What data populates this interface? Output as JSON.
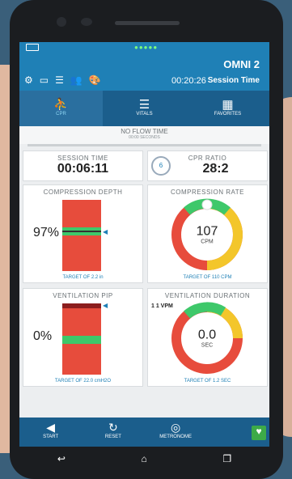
{
  "header": {
    "title": "OMNI 2",
    "session_label": "Session Time",
    "session_value": "00:20:26"
  },
  "tabs": [
    {
      "label": "FAVORITES",
      "icon": "grid-icon"
    },
    {
      "label": "VITALS",
      "icon": "sliders-icon"
    },
    {
      "label": "CPR",
      "icon": "cpr-icon"
    }
  ],
  "no_flow": {
    "label": "NO FLOW TIME",
    "sub": "00:00 SECONDS"
  },
  "session_card": {
    "label": "SESSION TIME",
    "value": "00:06:11"
  },
  "cpr_ratio": {
    "label": "CPR RATIO",
    "value": "28:2",
    "count": "6"
  },
  "compression_depth": {
    "label": "COMPRESSION DEPTH",
    "value": "97%",
    "target": "TARGET OF 2.2 in",
    "level": 0.97
  },
  "compression_rate": {
    "label": "COMPRESSION RATE",
    "value": "107",
    "unit": "CPM",
    "target": "TARGET OF 110 CPM"
  },
  "ventilation_pip": {
    "label": "VENTILATION PIP",
    "value": "0%",
    "target": "TARGET OF 22.0 cmH2O",
    "level": 0.0
  },
  "ventilation_duration": {
    "label": "VENTILATION DURATION",
    "value": "0.0",
    "unit": "SEC",
    "badge": "1 1 VPM",
    "target": "TARGET OF 1.2 SEC"
  },
  "navbar": [
    {
      "label": "START",
      "icon": "play-icon"
    },
    {
      "label": "RESET",
      "icon": "reset-icon"
    },
    {
      "label": "METRONOME",
      "icon": "metronome-icon"
    }
  ],
  "colors": {
    "primary": "#1f80b6",
    "navy": "#1b5e8c",
    "red": "#e74c3c",
    "green": "#3ec86a",
    "yellow": "#f3c62b"
  }
}
